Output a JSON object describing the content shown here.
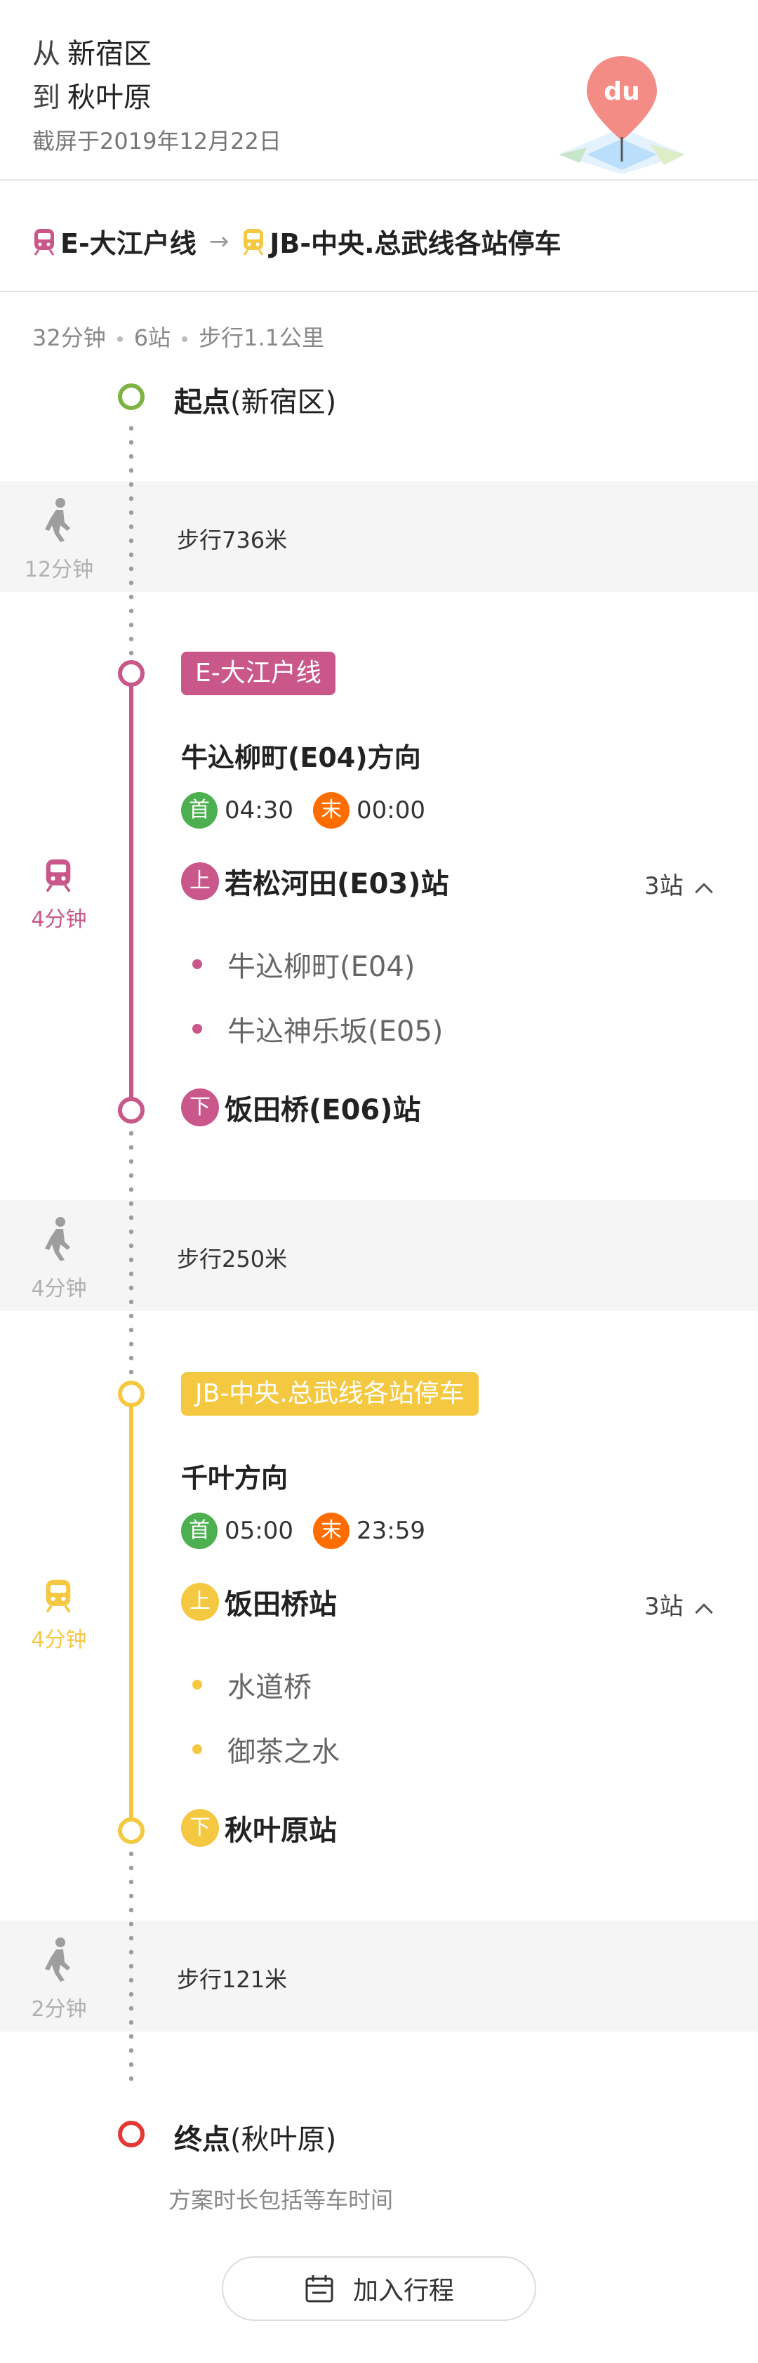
{
  "header": {
    "from_prefix": "从",
    "from": "新宿区",
    "to_prefix": "到",
    "to": "秋叶原",
    "screenshot_date": "截屏于2019年12月22日",
    "logo_text": "du"
  },
  "route_summary": {
    "line1": "E-大江户线",
    "arrow": "→",
    "line2": "JB-中央.总武线各站停车"
  },
  "meta": {
    "duration": "32分钟",
    "stations": "6站",
    "walk": "步行1.1公里"
  },
  "start": {
    "label": "起点",
    "place": "(新宿区)"
  },
  "walks": [
    {
      "text": "步行736米",
      "time": "12分钟"
    },
    {
      "text": "步行250米",
      "time": "4分钟"
    },
    {
      "text": "步行121米",
      "time": "2分钟"
    }
  ],
  "segments": [
    {
      "line": "E-大江户线",
      "direction": "牛込柳町(E04)方向",
      "first_badge": "首",
      "first_time": "04:30",
      "last_badge": "末",
      "last_time": "00:00",
      "board_badge": "上",
      "board": "若松河田(E03)站",
      "stops": "3站",
      "intermediate": [
        "牛込柳町(E04)",
        "牛込神乐坂(E05)"
      ],
      "alight_badge": "下",
      "alight": "饭田桥(E06)站",
      "duration": "4分钟",
      "color": "#c9578a"
    },
    {
      "line": "JB-中央.总武线各站停车",
      "direction": "千叶方向",
      "first_badge": "首",
      "first_time": "05:00",
      "last_badge": "末",
      "last_time": "23:59",
      "board_badge": "上",
      "board": "饭田桥站",
      "stops": "3站",
      "intermediate": [
        "水道桥",
        "御茶之水"
      ],
      "alight_badge": "下",
      "alight": "秋叶原站",
      "duration": "4分钟",
      "color": "#f5c842"
    }
  ],
  "end": {
    "label": "终点",
    "place": "(秋叶原)"
  },
  "note": "方案时长包括等车时间",
  "add_button": {
    "label": "加入行程",
    "icon": "calendar-icon"
  },
  "colors": {
    "start_node": "#7cb342",
    "end_node": "#e53935",
    "walk_icon": "#9e9e9e"
  }
}
